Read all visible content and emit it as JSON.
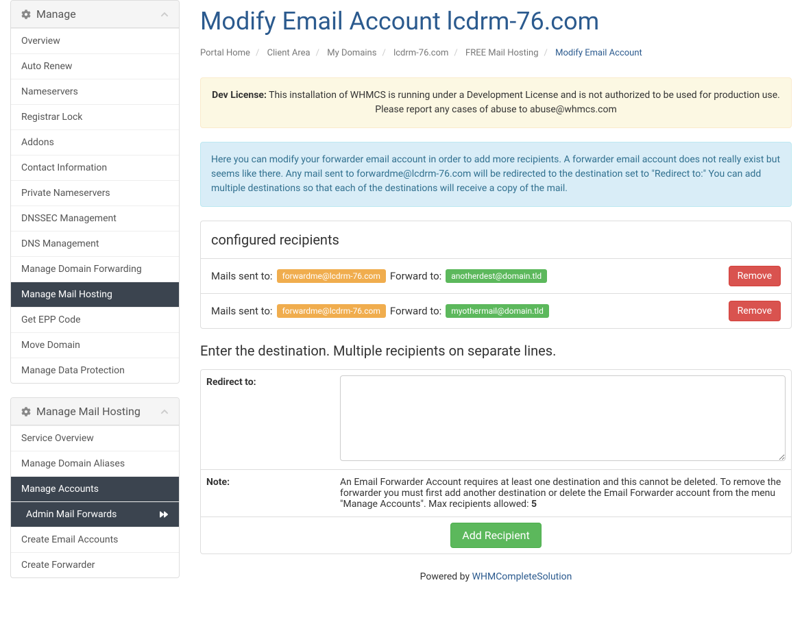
{
  "sidebar": {
    "manage": {
      "title": "Manage",
      "items": [
        {
          "label": "Overview"
        },
        {
          "label": "Auto Renew"
        },
        {
          "label": "Nameservers"
        },
        {
          "label": "Registrar Lock"
        },
        {
          "label": "Addons"
        },
        {
          "label": "Contact Information"
        },
        {
          "label": "Private Nameservers"
        },
        {
          "label": "DNSSEC Management"
        },
        {
          "label": "DNS Management"
        },
        {
          "label": "Manage Domain Forwarding"
        },
        {
          "label": "Manage Mail Hosting"
        },
        {
          "label": "Get EPP Code"
        },
        {
          "label": "Move Domain"
        },
        {
          "label": "Manage Data Protection"
        }
      ]
    },
    "mailhosting": {
      "title": "Manage Mail Hosting",
      "items": [
        {
          "label": "Service Overview"
        },
        {
          "label": "Manage Domain Aliases"
        },
        {
          "label": "Manage Accounts"
        },
        {
          "label": "Admin Mail Forwards"
        },
        {
          "label": "Create Email Accounts"
        },
        {
          "label": "Create Forwarder"
        }
      ]
    }
  },
  "page": {
    "title": "Modify Email Account lcdrm-76.com"
  },
  "breadcrumb": {
    "items": [
      {
        "label": "Portal Home"
      },
      {
        "label": "Client Area"
      },
      {
        "label": "My Domains"
      },
      {
        "label": "lcdrm-76.com"
      },
      {
        "label": "FREE Mail Hosting"
      }
    ],
    "current": "Modify Email Account"
  },
  "alerts": {
    "dev_label": "Dev License:",
    "dev_text": " This installation of WHMCS is running under a Development License and is not authorized to be used for production use. Please report any cases of abuse to abuse@whmcs.com",
    "info_text": "Here you can modify your forwarder email account in order to add more recipients. A forwarder email account does not really exist but seems like there. Any mail sent to forwardme@lcdrm-76.com will be redirected to the destination set to \"Redirect to:\" You can add multiple destinations so that each of the destinations will receive a copy of the mail."
  },
  "recipients": {
    "header": "configured recipients",
    "mails_sent_label": "Mails sent to:",
    "forward_to_label": "Forward to:",
    "remove_label": "Remove",
    "rows": [
      {
        "from": "forwardme@lcdrm-76.com",
        "to": "anotherdest@domain.tld"
      },
      {
        "from": "forwardme@lcdrm-76.com",
        "to": "myothermail@domain.tld"
      }
    ]
  },
  "form": {
    "intro": "Enter the destination. Multiple recipients on separate lines.",
    "redirect_label": "Redirect to:",
    "note_label": "Note:",
    "note_text_a": "An Email Forwarder Account requires at least one destination and this cannot be deleted. To remove the forwarder you must first add another destination or delete the Email Forwarder account from the menu \"Manage Accounts\". Max recipients allowed: ",
    "note_max": "5",
    "submit_label": "Add Recipient"
  },
  "footer": {
    "powered": "Powered by ",
    "brand": "WHMCompleteSolution"
  }
}
